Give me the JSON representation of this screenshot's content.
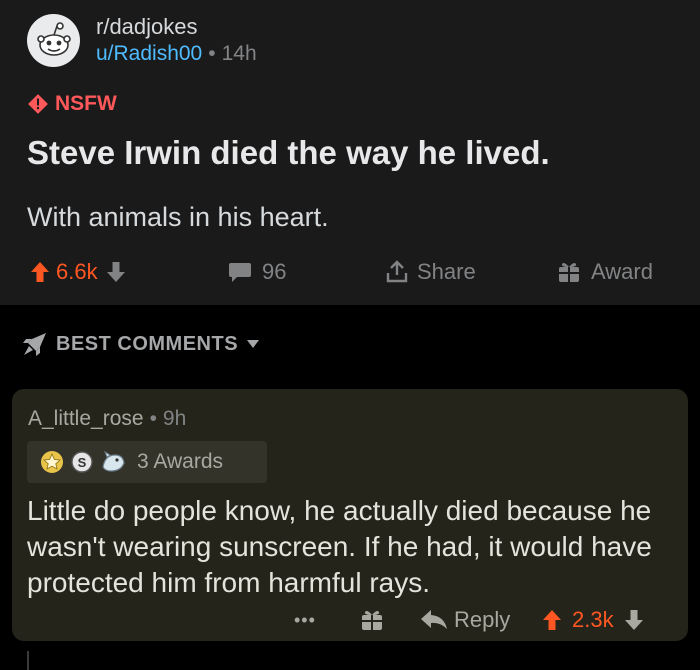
{
  "post": {
    "subreddit": "r/dadjokes",
    "author": "u/Radish00",
    "separator": "•",
    "time": "14h",
    "nsfw_label": "NSFW",
    "title": "Steve Irwin died the way he lived.",
    "body": "With animals in his heart.",
    "actions": {
      "votes": "6.6k",
      "comments": "96",
      "share": "Share",
      "award": "Award"
    }
  },
  "sort": {
    "label": "BEST COMMENTS"
  },
  "comment": {
    "author": "A_little_rose",
    "separator": "•",
    "time": "9h",
    "awards_label": "3 Awards",
    "body": "Little do people know, he actually died because he wasn't wearing sunscreen. If he had, it would have protected him from harmful rays.",
    "more": "•••",
    "reply": "Reply",
    "votes": "2.3k"
  },
  "colors": {
    "background": "#1a1a1b",
    "upvote": "#ff5722",
    "link": "#4fbcff",
    "nsfw": "#ff585b",
    "comment_highlight": "#24241a"
  }
}
